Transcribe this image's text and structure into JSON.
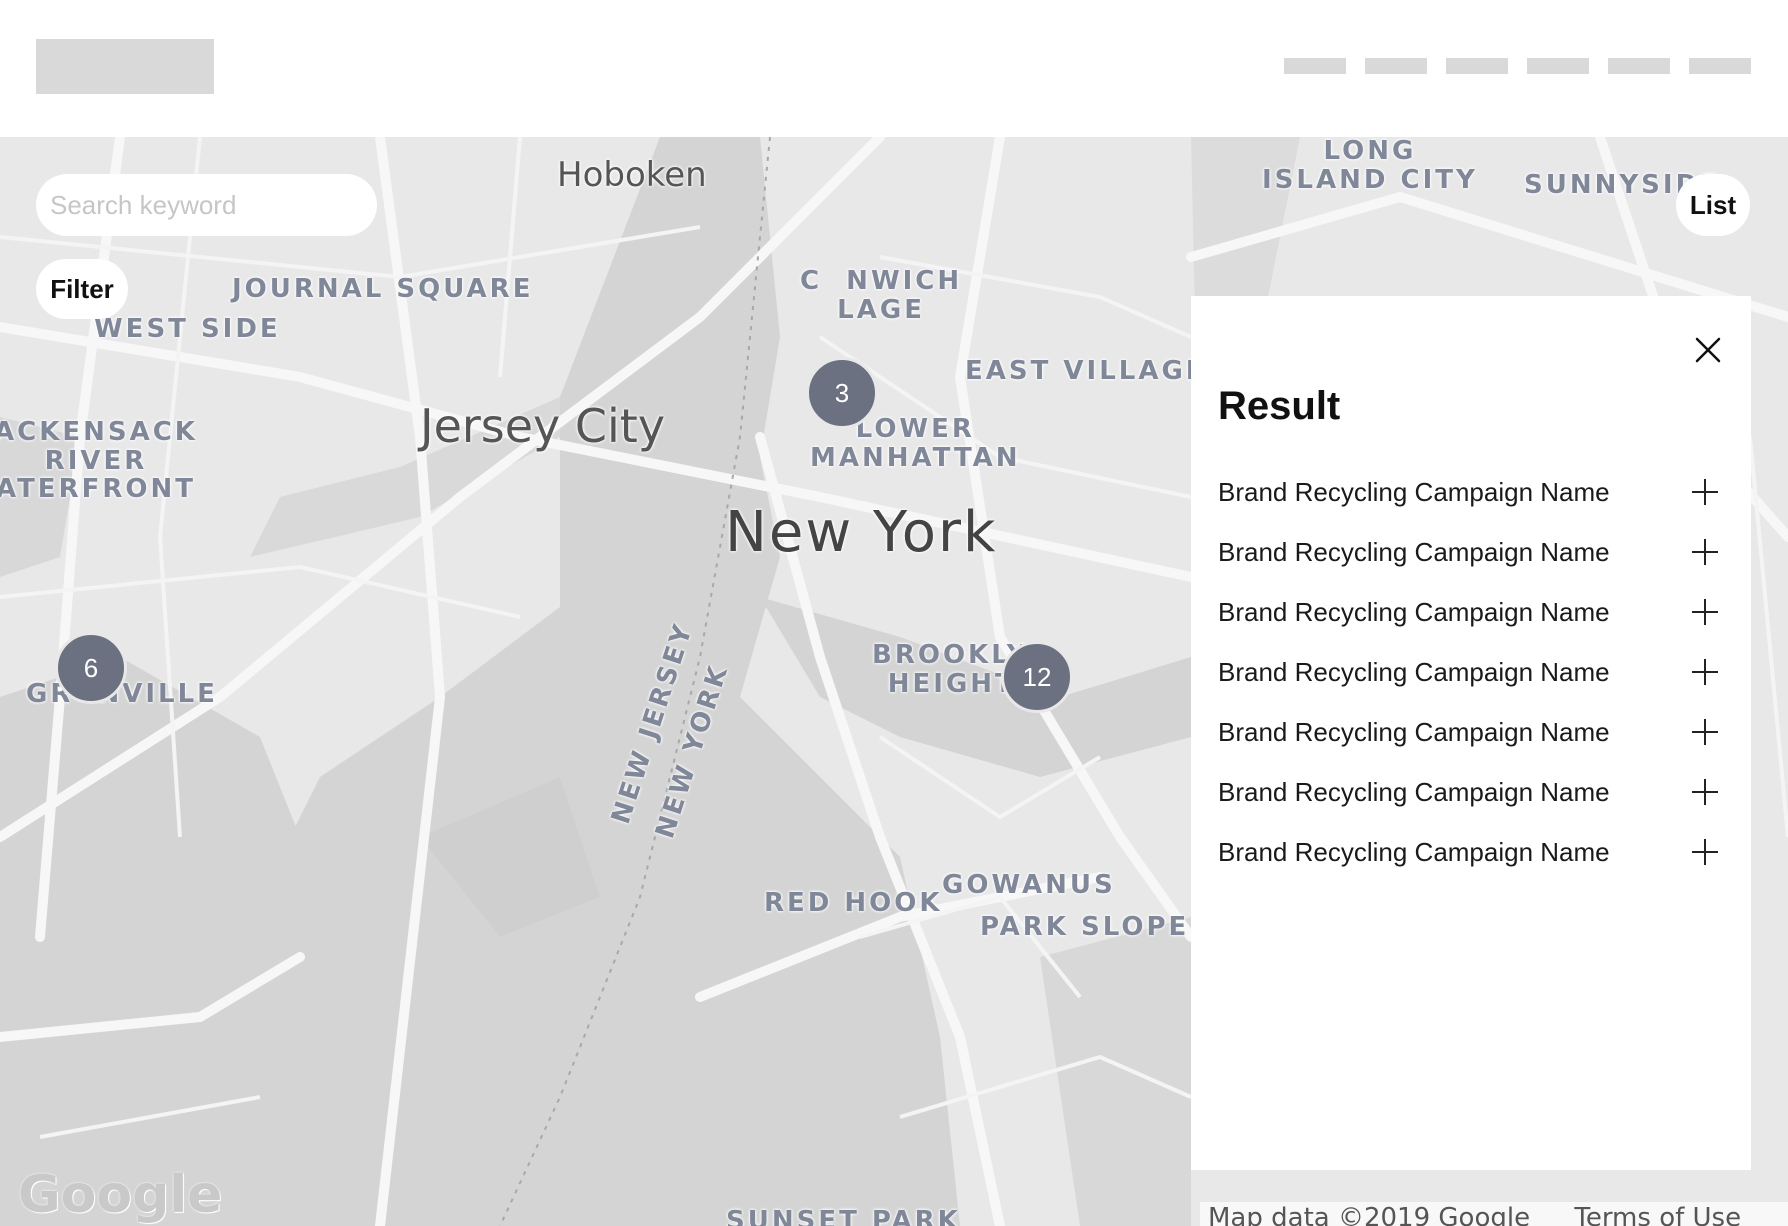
{
  "map": {
    "search_placeholder": "Search keyword",
    "filter_label": "Filter",
    "list_label": "List",
    "labels": [
      "Hoboken",
      "JOURNAL SQUARE",
      "WEST SIDE",
      "Jersey City",
      "ACKENSACK\nRIVER\nATERFRONT",
      "GR  NVILLE",
      "C  NWICH\nLAGE",
      "EAST VILLAGE",
      "LOWER\nMANHATTAN",
      "New York",
      "NEW JERSEY",
      "NEW YORK",
      "BROOKLYN\nHEIGHTS",
      "RED HOOK",
      "GOWANUS",
      "PARK SLOPE",
      "LONG\nISLAND CITY",
      "SUNNYSIDE",
      "SUNSET PARK"
    ],
    "clusters": [
      "3",
      "6",
      "12"
    ],
    "google_logo": "Google",
    "attribution": [
      "Map data ©2019 Google",
      "Terms of Use"
    ]
  },
  "panel": {
    "title": "Result",
    "items": [
      "Brand Recycling Campaign Name",
      "Brand Recycling Campaign Name",
      "Brand Recycling Campaign Name",
      "Brand Recycling Campaign Name",
      "Brand Recycling Campaign Name",
      "Brand Recycling Campaign Name",
      "Brand Recycling Campaign Name"
    ]
  },
  "colors": {
    "cluster": "#6b7180",
    "map_land": "#e8e8e8",
    "map_water": "#d4d4d4",
    "placeholder_block": "#d9d9d9"
  }
}
